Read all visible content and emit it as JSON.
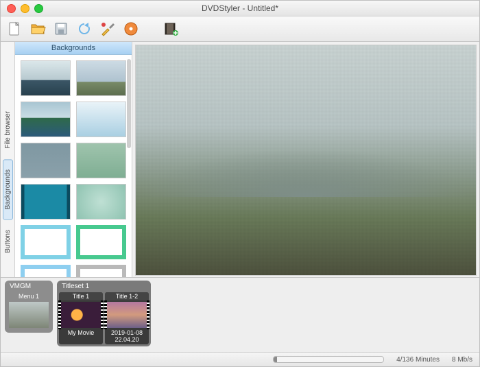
{
  "window": {
    "title": "DVDStyler - Untitled*"
  },
  "toolbar": {
    "icons": [
      "new-file-icon",
      "open-folder-icon",
      "save-icon",
      "refresh-icon",
      "tools-icon",
      "burn-disc-icon",
      "add-video-icon"
    ]
  },
  "side_tabs": [
    {
      "id": "file",
      "label": "File browser",
      "active": false
    },
    {
      "id": "bg",
      "label": "Backgrounds",
      "active": true
    },
    {
      "id": "buttons",
      "label": "Buttons",
      "active": false
    }
  ],
  "sidepanel": {
    "title": "Backgrounds",
    "thumbs": [
      "bg1",
      "bg2",
      "bg3",
      "bg4",
      "bg5",
      "bg6",
      "bg7",
      "bg8",
      "bg9",
      "bg10",
      "bg11",
      "bg12"
    ]
  },
  "timeline": {
    "group1": {
      "label": "VMGM",
      "clips": [
        {
          "head": "Menu 1",
          "caption": ""
        }
      ]
    },
    "group2": {
      "label": "Titleset 1",
      "clips": [
        {
          "head": "Title 1",
          "caption": "My Movie"
        },
        {
          "head": "Title 1-2",
          "caption": "2019-01-08 22.04.20"
        }
      ]
    }
  },
  "status": {
    "minutes": "4/136 Minutes",
    "bitrate": "8 Mb/s",
    "progress_pct": 3
  }
}
